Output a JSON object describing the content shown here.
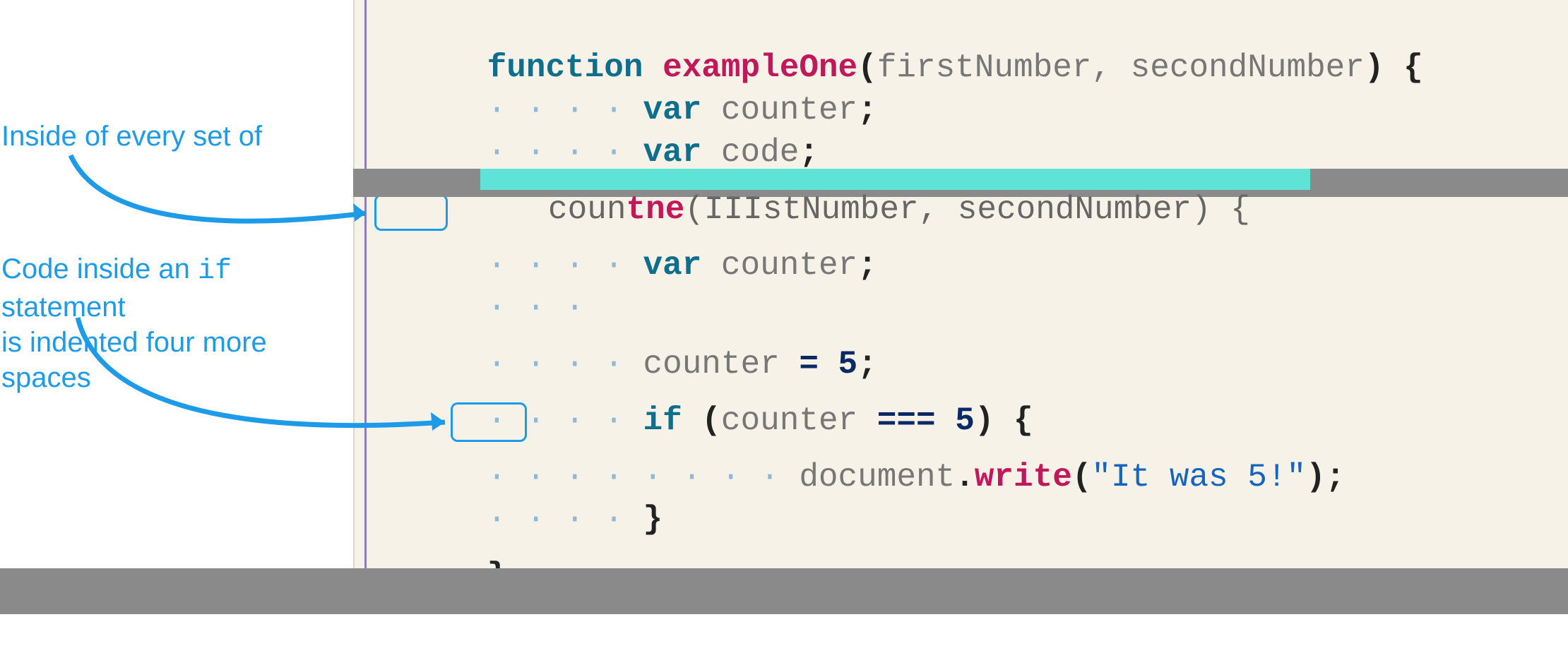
{
  "annotations": {
    "a1_line1": "Inside of every set of",
    "a2_line1_prefix": "Code inside an ",
    "a2_line1_code": "if",
    "a2_line1_suffix": " statement",
    "a2_line2": "is indented four more  spaces"
  },
  "code": {
    "kw_function": "function",
    "fn_name": "exampleOne",
    "params_open": "(",
    "param1": "firstNumber",
    "comma_sp": ", ",
    "param2": "secondNumber",
    "params_close": ")",
    "brace_open": " {",
    "kw_var": "var",
    "id_counter": "counter",
    "id_code": "code",
    "semi": ";",
    "assign_counter_lhs": "counter ",
    "op_eq": "=",
    "num5": " 5",
    "kw_if": "if",
    "cond_open": " (",
    "cond_lhs": "counter ",
    "op_seq": "===",
    "cond_rhs": " 5",
    "cond_close": ")",
    "doc_obj": "document",
    "dot": ".",
    "meth_write": "write",
    "call_open": "(",
    "str_arg": "\"It was 5!\"",
    "call_close": ")",
    "brace_close": "}",
    "glitch_prefix": "    coun",
    "glitch_fn": "tne",
    "glitch_rest": "(IIIstNumber, secondNumber) {"
  },
  "ws4": "· · · · ",
  "ws3": "· · · "
}
